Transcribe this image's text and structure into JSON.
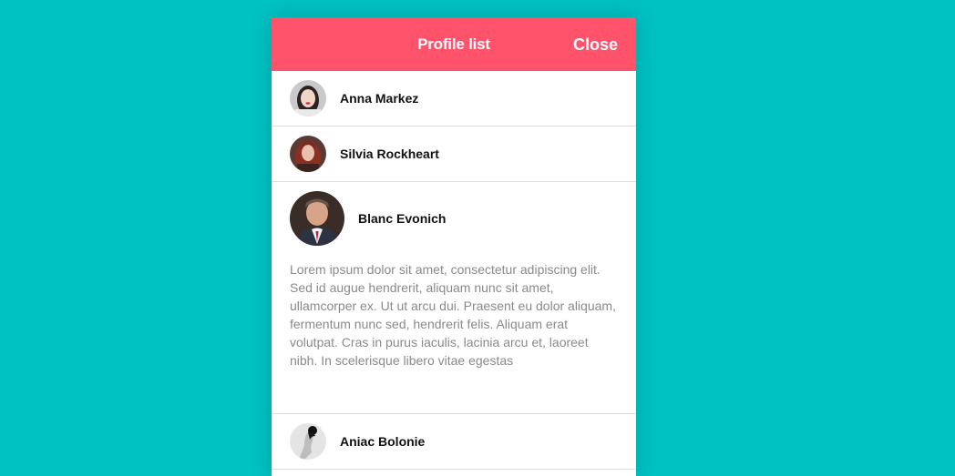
{
  "header": {
    "title": "Profile list",
    "close_label": "Close"
  },
  "profiles": [
    {
      "name": "Anna Markez",
      "avatar": "avatar-photo-woman",
      "expanded": false
    },
    {
      "name": "Silvia Rockheart",
      "avatar": "avatar-photo-woman-redhair",
      "expanded": false
    },
    {
      "name": "Blanc Evonich",
      "avatar": "avatar-photo-man-suit",
      "expanded": true,
      "bio": "Lorem ipsum dolor sit amet, consectetur adipiscing elit. Sed id augue hendrerit, aliquam nunc sit amet, ullamcorper ex. Ut ut arcu dui. Praesent eu dolor aliquam, fermentum nunc sed, hendrerit felis. Aliquam erat volutpat. Cras in purus iaculis, lacinia arcu et, laoreet nibh. In scelerisque libero vitae egestas"
    },
    {
      "name": "Aniac Bolonie",
      "avatar": "avatar-photo-woman-silhouette",
      "expanded": false
    }
  ],
  "colors": {
    "background": "#00c2c2",
    "header": "#ff526b",
    "divider": "#dcdcdc",
    "bio_text": "#8a8a8a"
  }
}
